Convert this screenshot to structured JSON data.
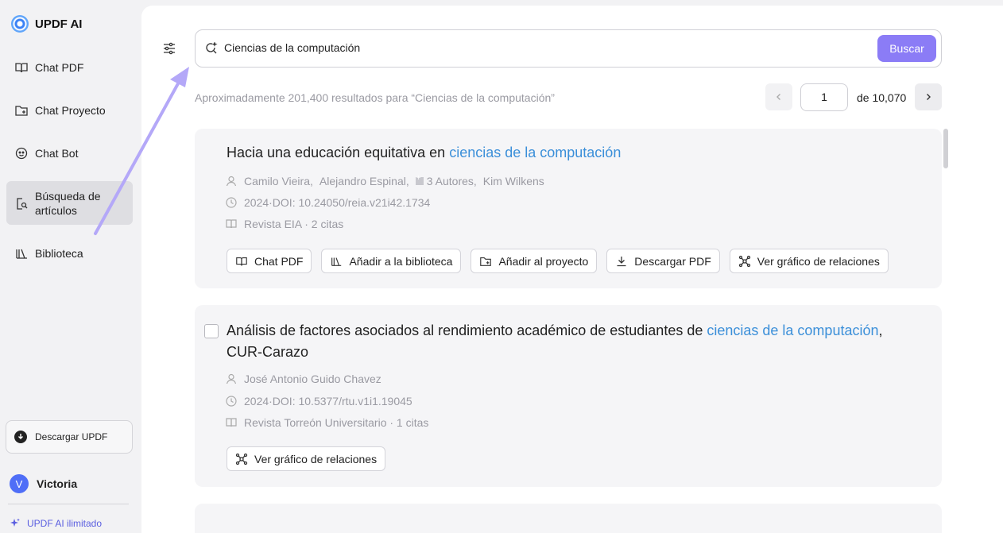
{
  "sidebar": {
    "brand": "UPDF AI",
    "items": [
      {
        "label": "Chat PDF",
        "icon": "book-open-icon"
      },
      {
        "label": "Chat Proyecto",
        "icon": "folder-icon"
      },
      {
        "label": "Chat Bot",
        "icon": "bot-icon"
      },
      {
        "label": "Búsqueda de artículos",
        "icon": "search-document-icon",
        "active": true
      },
      {
        "label": "Biblioteca",
        "icon": "library-icon"
      }
    ],
    "download_label": "Descargar UPDF",
    "user": {
      "initial": "V",
      "name": "Victoria"
    },
    "unlimited_label": "UPDF AI ilimitado"
  },
  "search": {
    "value": "Ciencias de la computación",
    "button_label": "Buscar"
  },
  "results": {
    "summary": "Aproximadamente 201,400 resultados para “Ciencias de la computación”",
    "page": "1",
    "page_total": "de 10,070"
  },
  "cards": [
    {
      "title_prefix": "Hacia una educación equitativa en ",
      "title_highlight": "ciencias de la computación",
      "title_suffix": "",
      "title_line2": "",
      "authors": [
        "Camilo Vieira,",
        "Alejandro Espinal,",
        "3 Autores,",
        "Kim Wilkens"
      ],
      "doi": "2024·DOI: 10.24050/reia.v21i42.1734",
      "journal": "Revista EIA · 2 citas",
      "actions": [
        "Chat PDF",
        "Añadir a la biblioteca",
        "Añadir al proyecto",
        "Descargar PDF",
        "Ver gráfico de relaciones"
      ]
    },
    {
      "title_prefix": "Análisis de factores asociados al rendimiento académico de estudiantes de ",
      "title_highlight": "ciencias de la computación",
      "title_suffix": ",",
      "title_line2": "CUR-Carazo",
      "authors": [
        "José Antonio Guido Chavez"
      ],
      "doi": "2024·DOI: 10.5377/rtu.v1i1.19045",
      "journal": "Revista Torreón Universitario · 1 citas",
      "actions": [
        "Ver gráfico de relaciones"
      ]
    }
  ],
  "colors": {
    "accent": "#8b7cf6",
    "highlight": "#3b8fd9",
    "annotation_arrow": "#b4a8f8"
  }
}
